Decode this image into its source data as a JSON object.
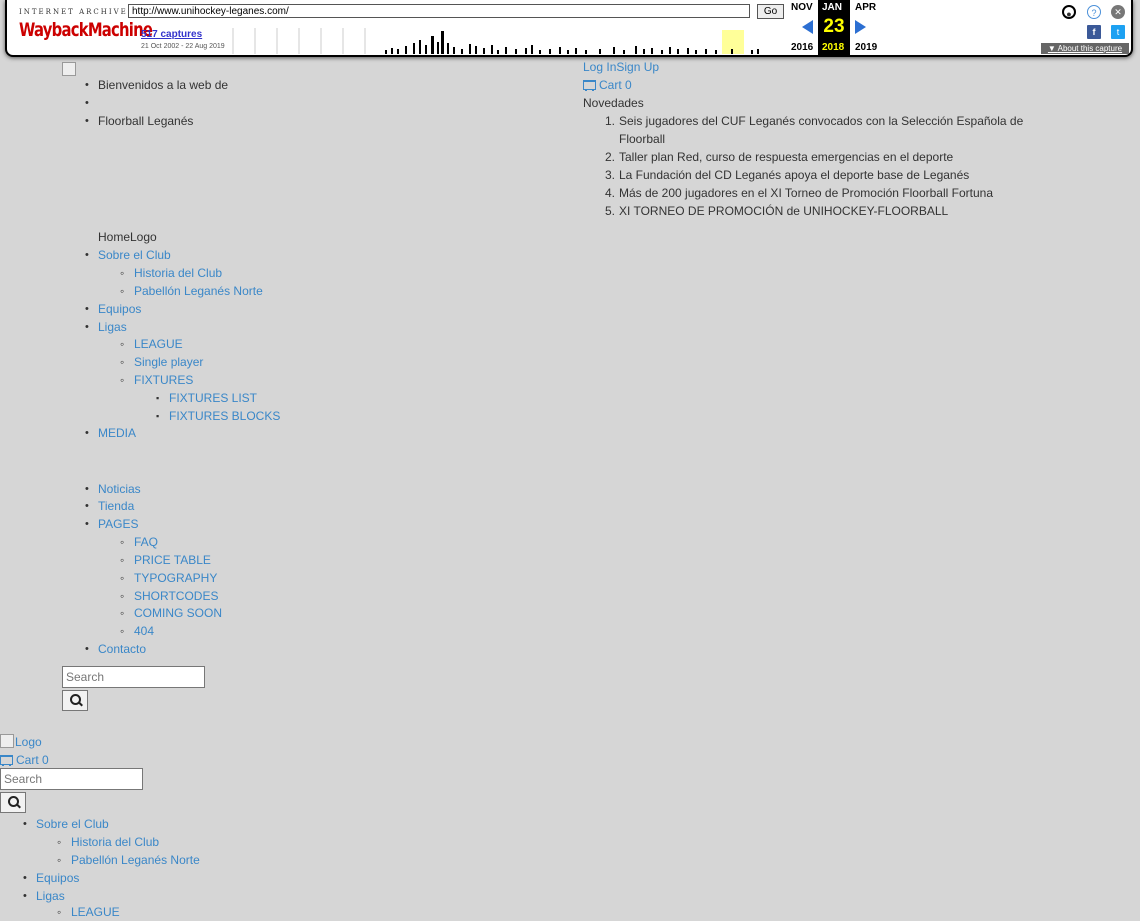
{
  "wayback": {
    "logo_top": "INTERNET ARCHIVE",
    "logo_main": "WaybackMachine",
    "url": "http://www.unihockey-leganes.com/",
    "go_label": "Go",
    "captures": "517 captures",
    "date_range": "21 Oct 2002 - 22 Aug 2019",
    "months": {
      "prev": "NOV",
      "current": "JAN",
      "next": "APR"
    },
    "day": "23",
    "years": {
      "prev": "2016",
      "current": "2018",
      "next": "2019"
    },
    "about_label": "About this capture",
    "accent_color": "#ffff00"
  },
  "page": {
    "intro_items": [
      "Bienvenidos a la web de",
      "",
      "Floorball Leganés"
    ],
    "account": {
      "login": "Log In",
      "signup": "Sign Up",
      "cart": "Cart 0"
    },
    "news_title": "Novedades",
    "news": [
      "Seis jugadores del CUF Leganés convocados con la Selección Española de",
      "Floorball",
      "Taller plan Red, curso de respuesta emergencias en el deporte",
      "La Fundación del CD Leganés apoya el deporte base de Leganés",
      "Más de 200 jugadores en el XI Torneo de Promoción Floorball Fortuna",
      "XI TORNEO DE PROMOCIÓN de UNIHOCKEY-FLOORBALL"
    ],
    "news_numbers": [
      "1.",
      "2.",
      "3.",
      "4.",
      "5."
    ],
    "home_logo": "HomeLogo",
    "menu": {
      "sobre": "Sobre el Club",
      "historia": "Historia del Club",
      "pabellon": "Pabellón Leganés Norte",
      "equipos": "Equipos",
      "ligas": "Ligas",
      "league": "LEAGUE",
      "single": "Single player",
      "fixtures": "FIXTURES",
      "fixtures_list": "FIXTURES LIST",
      "fixtures_blocks": "FIXTURES BLOCKS",
      "media": "MEDIA",
      "noticias": "Noticias",
      "tienda": "Tienda",
      "pages": "PAGES",
      "faq": "FAQ",
      "price": "PRICE TABLE",
      "typography": "TYPOGRAPHY",
      "shortcodes": "SHORTCODES",
      "coming": "COMING SOON",
      "e404": "404",
      "contacto": "Contacto"
    },
    "search_placeholder": "Search",
    "mobile": {
      "logo_alt": "Logo",
      "cart": "Cart 0",
      "search_placeholder": "Search"
    }
  }
}
